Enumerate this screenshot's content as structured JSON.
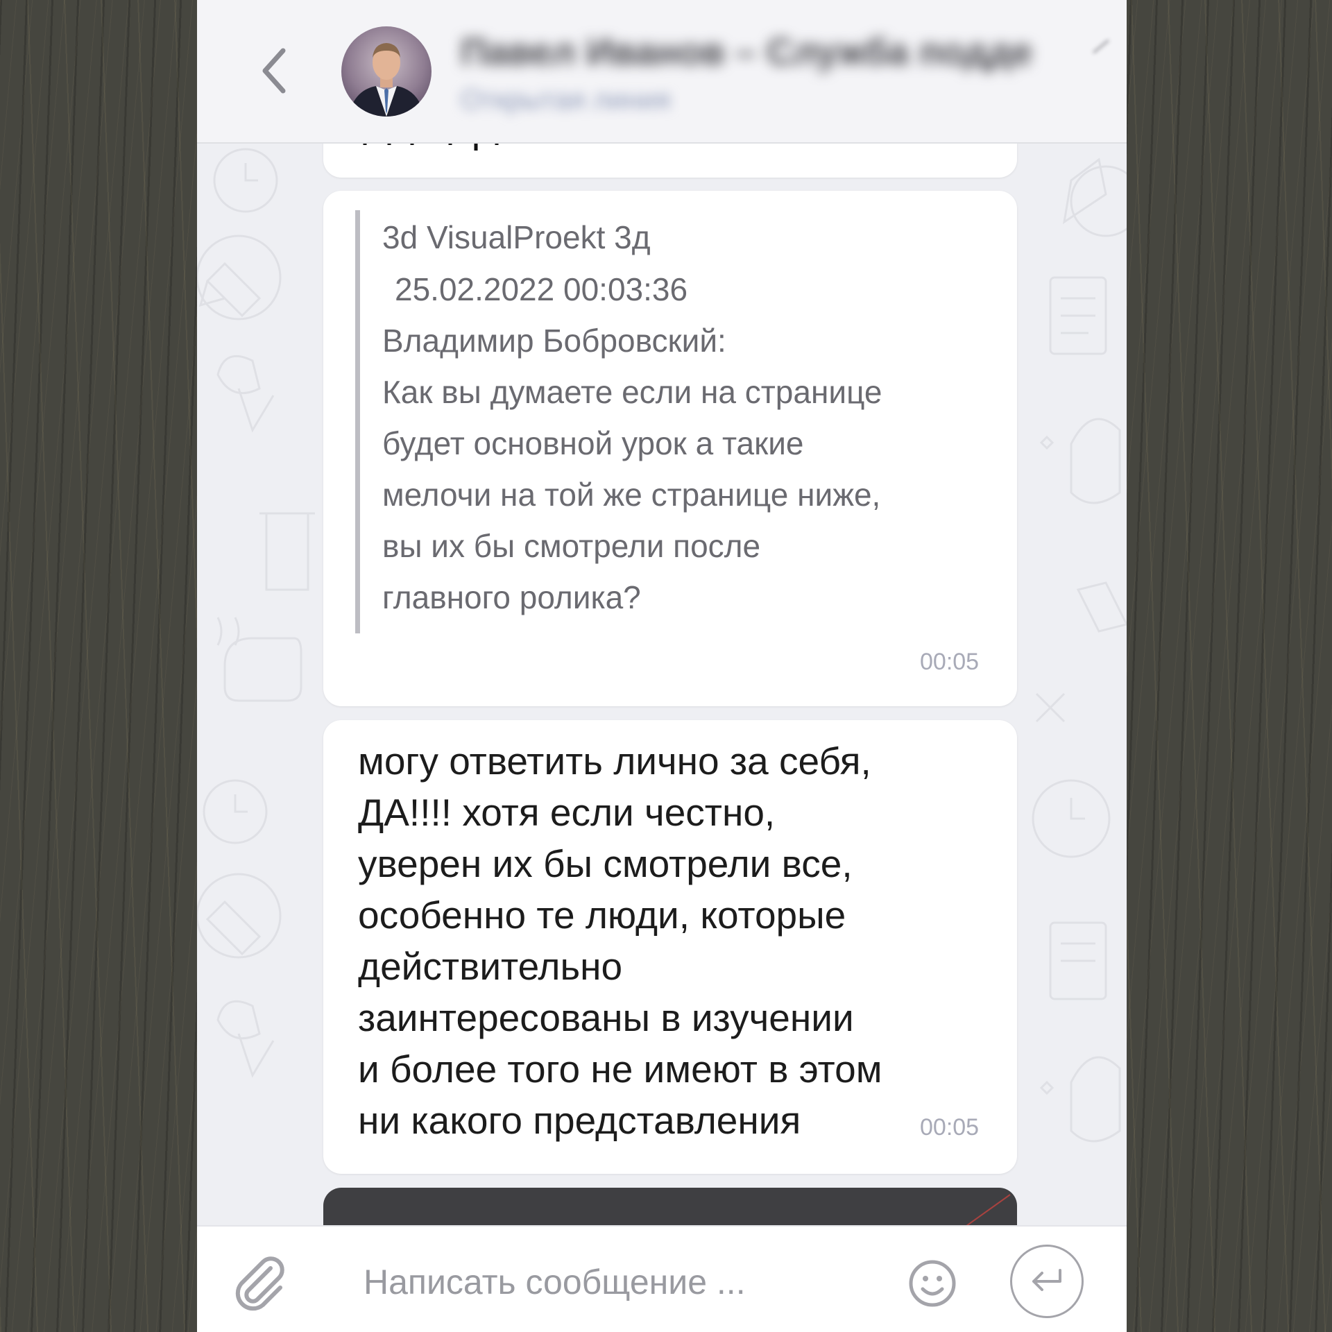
{
  "header": {
    "contact_name": "Павел Иванов – Служба подде",
    "subtitle": "Открытая линия"
  },
  "messages": [
    {
      "type": "incoming",
      "quote": {
        "author": "3d VisualProekt 3д",
        "datetime": "25.02.2022 00:03:36",
        "lines": [
          "Владимир Бобровский:",
          "Как вы думаете если на странице",
          "будет основной урок а такие",
          "мелочи на той же странице ниже,",
          "вы их бы смотрели после",
          "главного ролика?"
        ]
      },
      "time": "00:05"
    },
    {
      "type": "incoming",
      "lines": [
        "могу ответить лично за себя,",
        "ДА!!!!  хотя если честно,",
        "уверен их бы смотрели все,",
        "особенно те люди, которые",
        "действительно",
        "заинтересованы в изучении",
        "и более того не имеют в этом",
        "ни какого представления"
      ],
      "time": "00:05"
    }
  ],
  "composer": {
    "placeholder": "Написать сообщение ..."
  },
  "icons": {
    "back": "chevron-left-icon",
    "attach": "paperclip-icon",
    "emoji": "smiley-icon",
    "send": "return-arrow-icon"
  },
  "colors": {
    "chat_background": "#eeeff3",
    "bubble": "#ffffff",
    "timestamp": "#a8aab7",
    "quote_text": "#6a6a70"
  }
}
